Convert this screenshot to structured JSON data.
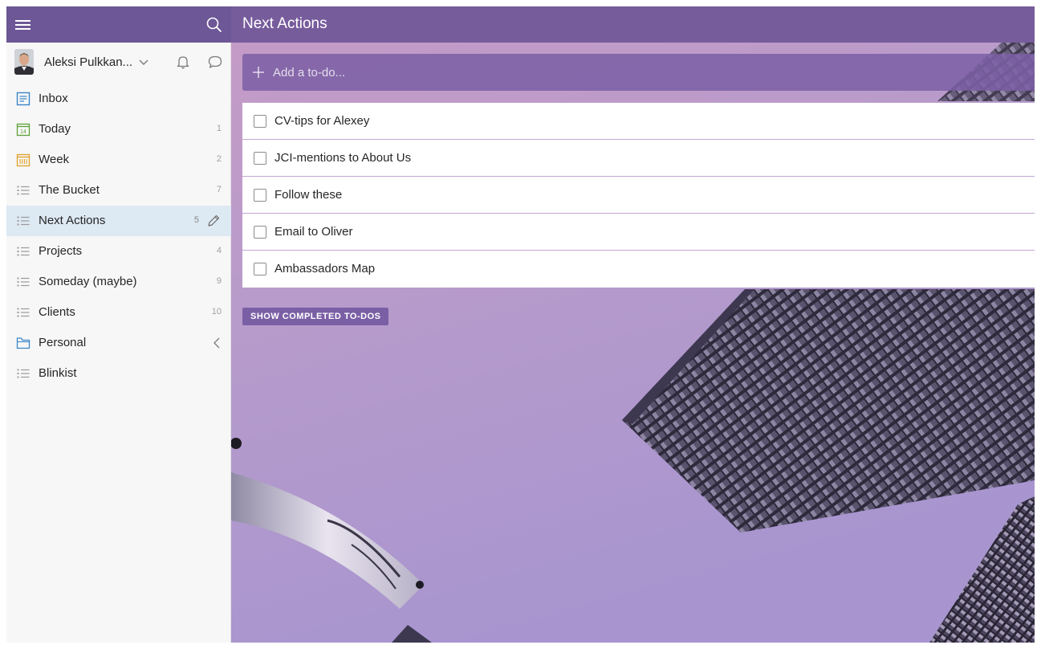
{
  "sidebar": {
    "user": {
      "name": "Aleksi Pulkkan..."
    },
    "items": [
      {
        "label": "Inbox",
        "count": "",
        "icon": "inbox-icon"
      },
      {
        "label": "Today",
        "count": "1",
        "icon": "calendar-today-icon",
        "icon_text": "14"
      },
      {
        "label": "Week",
        "count": "2",
        "icon": "calendar-week-icon"
      },
      {
        "label": "The Bucket",
        "count": "7",
        "icon": "list-icon"
      },
      {
        "label": "Next Actions",
        "count": "5",
        "icon": "list-icon",
        "active": true
      },
      {
        "label": "Projects",
        "count": "4",
        "icon": "list-icon"
      },
      {
        "label": "Someday (maybe)",
        "count": "9",
        "icon": "list-icon"
      },
      {
        "label": "Clients",
        "count": "10",
        "icon": "list-icon"
      },
      {
        "label": "Personal",
        "count": "",
        "icon": "folder-icon"
      },
      {
        "label": "Blinkist",
        "count": "",
        "icon": "list-icon"
      }
    ]
  },
  "main": {
    "title": "Next Actions",
    "add_placeholder": "Add a to-do...",
    "todos": [
      {
        "title": "CV-tips for Alexey",
        "done": false
      },
      {
        "title": "JCI-mentions to About Us",
        "done": false
      },
      {
        "title": "Follow these",
        "done": false
      },
      {
        "title": "Email to Oliver",
        "done": false
      },
      {
        "title": "Ambassadors Map",
        "done": false
      }
    ],
    "show_completed_label": "SHOW COMPLETED TO-DOS"
  },
  "colors": {
    "header_purple": "#775c9c",
    "sidebar_header": "#6d5796",
    "active_item_bg": "#dde9f3",
    "button_purple": "#7a5fa5"
  }
}
